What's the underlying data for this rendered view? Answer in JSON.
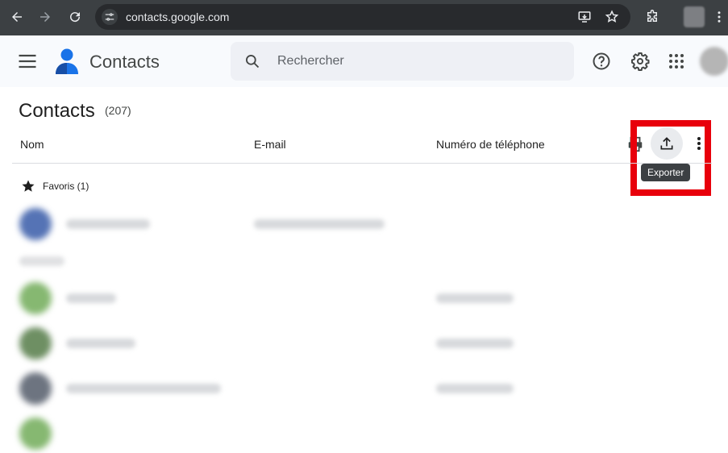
{
  "browser": {
    "url": "contacts.google.com"
  },
  "app": {
    "title": "Contacts"
  },
  "search": {
    "placeholder": "Rechercher"
  },
  "main": {
    "title": "Contacts",
    "count": "(207)",
    "columns": [
      "Nom",
      "E-mail",
      "Numéro de téléphone"
    ],
    "toolbar": {
      "export_tooltip": "Exporter"
    },
    "favorites_label": "Favoris (1)"
  },
  "colors": {
    "highlight": "#e8000b",
    "brand_blue": "#1a73e8"
  }
}
